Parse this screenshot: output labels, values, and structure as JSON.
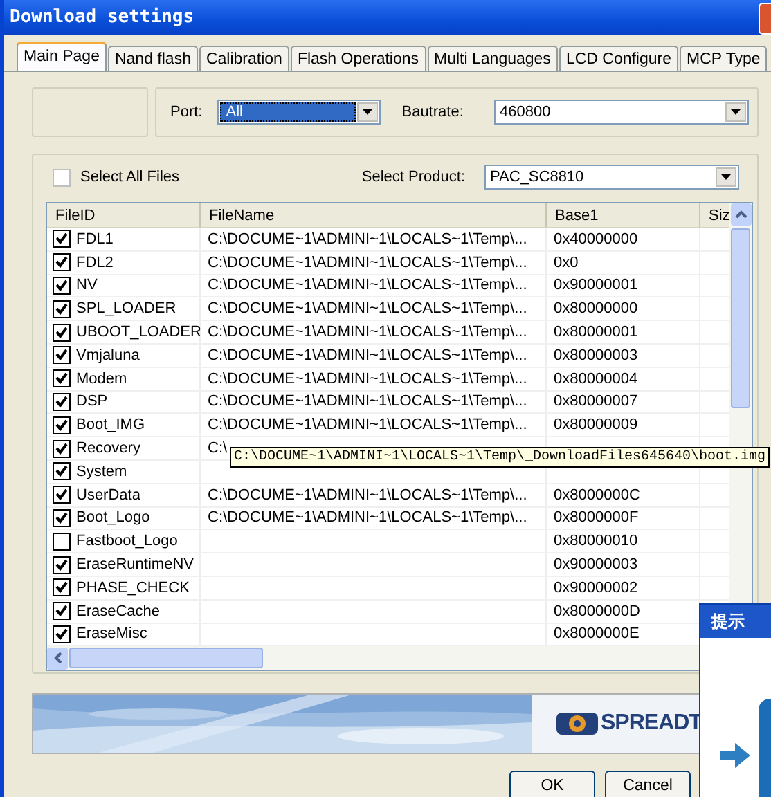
{
  "window": {
    "title": "Download settings"
  },
  "tabs": [
    {
      "label": "Main Page",
      "selected": true
    },
    {
      "label": "Nand flash",
      "selected": false
    },
    {
      "label": "Calibration",
      "selected": false
    },
    {
      "label": "Flash Operations",
      "selected": false
    },
    {
      "label": "Multi Languages",
      "selected": false
    },
    {
      "label": "LCD Configure",
      "selected": false
    },
    {
      "label": "MCP Type",
      "selected": false
    }
  ],
  "port": {
    "label": "Port:",
    "value": "All"
  },
  "bautrate": {
    "label": "Bautrate:",
    "value": "460800"
  },
  "select_all": {
    "label": "Select All Files",
    "checked": false
  },
  "product": {
    "label": "Select Product:",
    "value": "PAC_SC8810"
  },
  "table": {
    "columns": [
      "FileID",
      "FileName",
      "Base1",
      "Siz"
    ],
    "rows": [
      {
        "file_id": "FDL1",
        "checked": true,
        "file_name": "C:\\DOCUME~1\\ADMINI~1\\LOCALS~1\\Temp\\...",
        "base1": "0x40000000"
      },
      {
        "file_id": "FDL2",
        "checked": true,
        "file_name": "C:\\DOCUME~1\\ADMINI~1\\LOCALS~1\\Temp\\...",
        "base1": "0x0"
      },
      {
        "file_id": "NV",
        "checked": true,
        "file_name": "C:\\DOCUME~1\\ADMINI~1\\LOCALS~1\\Temp\\...",
        "base1": "0x90000001"
      },
      {
        "file_id": "SPL_LOADER",
        "checked": true,
        "file_name": "C:\\DOCUME~1\\ADMINI~1\\LOCALS~1\\Temp\\...",
        "base1": "0x80000000"
      },
      {
        "file_id": "UBOOT_LOADER",
        "checked": true,
        "file_name": "C:\\DOCUME~1\\ADMINI~1\\LOCALS~1\\Temp\\...",
        "base1": "0x80000001"
      },
      {
        "file_id": "Vmjaluna",
        "checked": true,
        "file_name": "C:\\DOCUME~1\\ADMINI~1\\LOCALS~1\\Temp\\...",
        "base1": "0x80000003"
      },
      {
        "file_id": "Modem",
        "checked": true,
        "file_name": "C:\\DOCUME~1\\ADMINI~1\\LOCALS~1\\Temp\\...",
        "base1": "0x80000004"
      },
      {
        "file_id": "DSP",
        "checked": true,
        "file_name": "C:\\DOCUME~1\\ADMINI~1\\LOCALS~1\\Temp\\...",
        "base1": "0x80000007"
      },
      {
        "file_id": "Boot_IMG",
        "checked": true,
        "file_name": "C:\\DOCUME~1\\ADMINI~1\\LOCALS~1\\Temp\\...",
        "base1": "0x80000009"
      },
      {
        "file_id": "Recovery",
        "checked": true,
        "file_name": "C:\\"
      },
      {
        "file_id": "System",
        "checked": true
      },
      {
        "file_id": "UserData",
        "checked": true,
        "file_name": "C:\\DOCUME~1\\ADMINI~1\\LOCALS~1\\Temp\\...",
        "base1": "0x8000000C"
      },
      {
        "file_id": "Boot_Logo",
        "checked": true,
        "file_name": "C:\\DOCUME~1\\ADMINI~1\\LOCALS~1\\Temp\\...",
        "base1": "0x8000000F"
      },
      {
        "file_id": "Fastboot_Logo",
        "checked": false,
        "base1": "0x80000010"
      },
      {
        "file_id": "EraseRuntimeNV",
        "checked": true,
        "base1": "0x90000003"
      },
      {
        "file_id": "PHASE_CHECK",
        "checked": true,
        "base1": "0x90000002"
      },
      {
        "file_id": "EraseCache",
        "checked": true,
        "base1": "0x8000000D"
      },
      {
        "file_id": "EraseMisc",
        "checked": true,
        "base1": "0x8000000E"
      }
    ]
  },
  "tooltip": "C:\\DOCUME~1\\ADMINI~1\\LOCALS~1\\Temp\\_DownloadFiles645640\\boot.img",
  "banner": {
    "logo_text": "SPREADT"
  },
  "buttons": [
    "OK",
    "Cancel"
  ],
  "popup": {
    "title": "提示"
  }
}
